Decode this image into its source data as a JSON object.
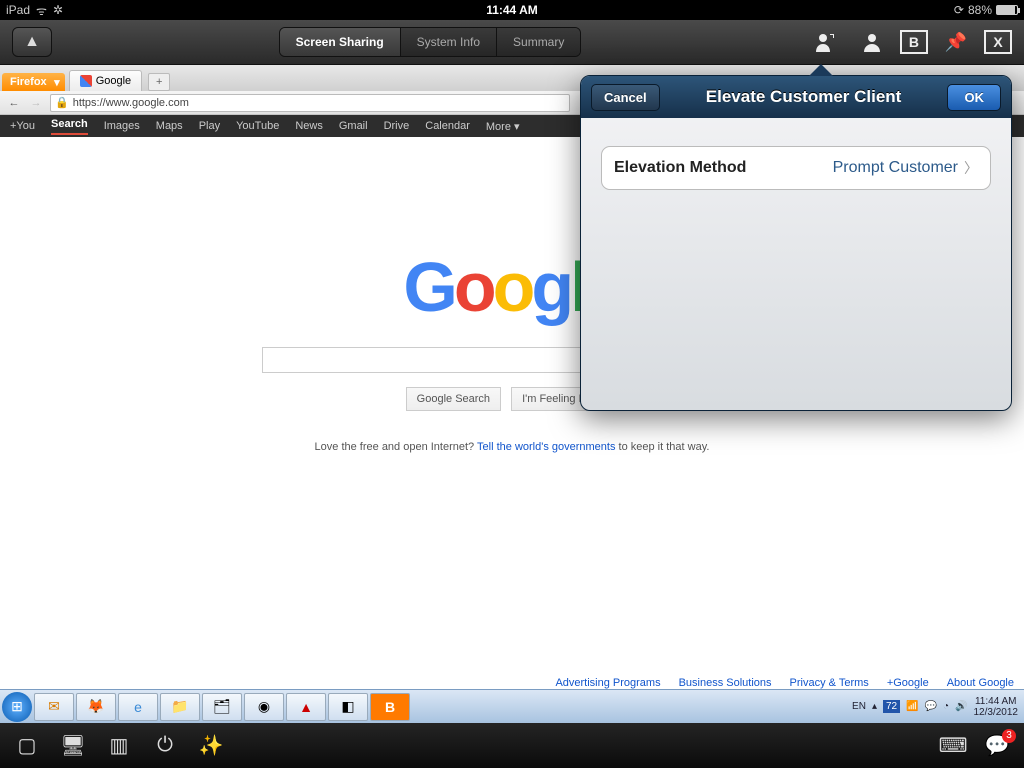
{
  "ios_status": {
    "carrier": "iPad",
    "time": "11:44 AM",
    "battery_pct": "88%"
  },
  "toolbar": {
    "tabs": [
      "Screen Sharing",
      "System Info",
      "Summary"
    ],
    "active_tab": 0
  },
  "popover": {
    "title": "Elevate Customer Client",
    "cancel": "Cancel",
    "ok": "OK",
    "row_label": "Elevation Method",
    "row_value": "Prompt Customer"
  },
  "firefox": {
    "button": "Firefox",
    "tab_title": "Google",
    "url": "https://www.google.com"
  },
  "google": {
    "bar": [
      "+You",
      "Search",
      "Images",
      "Maps",
      "Play",
      "YouTube",
      "News",
      "Gmail",
      "Drive",
      "Calendar",
      "More ▾"
    ],
    "search_btn": "Google Search",
    "lucky_btn": "I'm Feeling Lucky",
    "msg_pre": "Love the free and open Internet? ",
    "msg_link": "Tell the world's governments",
    "msg_post": " to keep it that way.",
    "footer": [
      "Advertising Programs",
      "Business Solutions",
      "Privacy & Terms",
      "+Google",
      "About Google"
    ]
  },
  "win": {
    "lang": "EN",
    "temp": "72",
    "time": "11:44 AM",
    "date": "12/3/2012"
  },
  "chat_badge": "3"
}
